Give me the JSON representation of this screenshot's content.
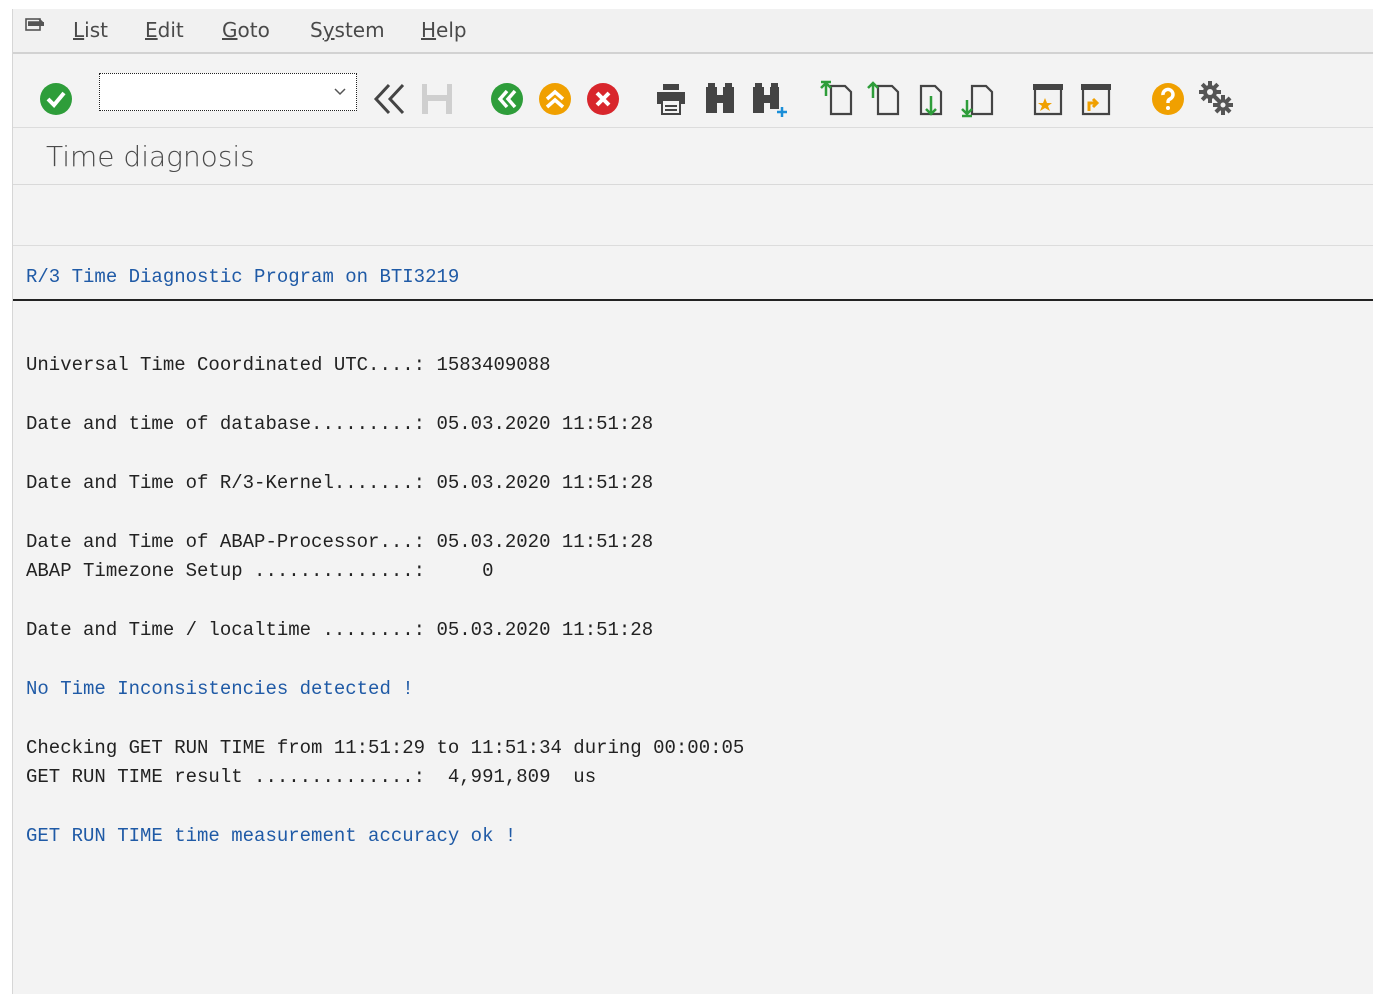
{
  "menu": {
    "items": [
      {
        "key": "list",
        "accel": "L",
        "rest": "ist"
      },
      {
        "key": "edit",
        "accel": "E",
        "rest": "dit"
      },
      {
        "key": "goto",
        "accel": "G",
        "rest": "oto"
      },
      {
        "key": "system",
        "pre": "S",
        "accel": "y",
        "rest": "stem"
      },
      {
        "key": "help",
        "accel": "H",
        "rest": "elp"
      }
    ]
  },
  "toolbar": {
    "command_field_value": "",
    "icons": [
      "enter-icon",
      "command-field-dropdown-icon",
      "back-double-chevron-icon",
      "save-icon",
      "back-icon",
      "exit-icon",
      "cancel-icon",
      "print-icon",
      "find-icon",
      "find-next-icon",
      "first-page-icon",
      "previous-page-icon",
      "next-page-icon",
      "last-page-icon",
      "create-session-icon",
      "generate-shortcut-icon",
      "help-icon",
      "customize-layout-icon"
    ]
  },
  "title": "Time diagnosis",
  "list": {
    "header": "R/3 Time Diagnostic Program on BTI3219",
    "lines": [
      "Universal Time Coordinated UTC....: 1583409088",
      "Date and time of database.........: 05.03.2020 11:51:28",
      "Date and Time of R/3-Kernel.......: 05.03.2020 11:51:28",
      "Date and Time of ABAP-Processor...: 05.03.2020 11:51:28",
      "ABAP Timezone Setup ..............:     0",
      "Date and Time / localtime ........: 05.03.2020 11:51:28",
      "No Time Inconsistencies detected !",
      "Checking GET RUN TIME from 11:51:29 to 11:51:34 during 00:00:05",
      "GET RUN TIME result ..............:  4,991,809  us",
      "GET RUN TIME time measurement accuracy ok !"
    ]
  },
  "colors": {
    "accent_green": "#2e9d3a",
    "accent_orange": "#f0a000",
    "accent_red": "#d8262c",
    "list_blue": "#1f5aa6"
  }
}
